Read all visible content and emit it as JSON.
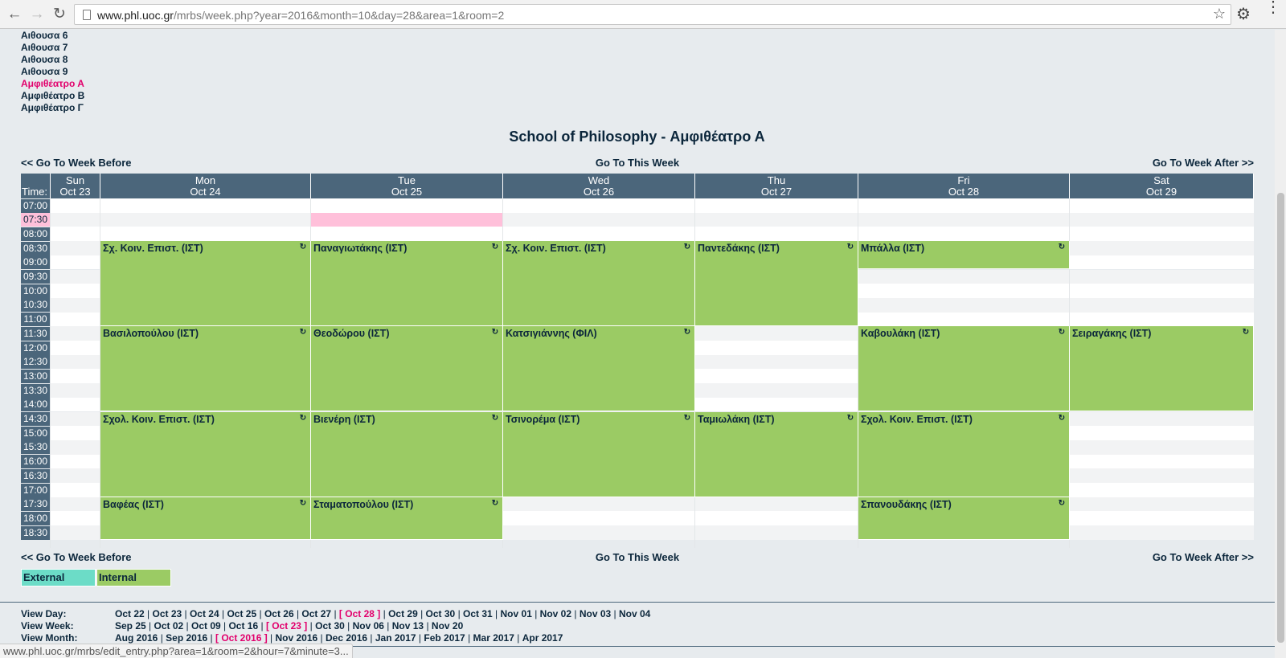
{
  "browser": {
    "url_host": "www.phl.uoc.gr",
    "url_path": "/mrbs/week.php?year=2016&month=10&day=28&area=1&room=2",
    "status_url": "www.phl.uoc.gr/mrbs/edit_entry.php?area=1&room=2&hour=7&minute=3..."
  },
  "rooms": [
    {
      "label": "Αιθουσα 6",
      "current": false
    },
    {
      "label": "Αιθουσα 7",
      "current": false
    },
    {
      "label": "Αιθουσα 8",
      "current": false
    },
    {
      "label": "Αιθουσα 9",
      "current": false
    },
    {
      "label": "Αμφιθέατρο Α",
      "current": true
    },
    {
      "label": "Αμφιθέατρο Β",
      "current": false
    },
    {
      "label": "Αμφιθέατρο Γ",
      "current": false
    }
  ],
  "page_title": "School of Philosophy - Αμφιθέατρο Α",
  "week_nav": {
    "prev": "<< Go To Week Before",
    "this": "Go To This Week",
    "next": "Go To Week After >>"
  },
  "time_label": "Time:",
  "days": [
    {
      "name": "Sun",
      "date": "Oct 23"
    },
    {
      "name": "Mon",
      "date": "Oct 24"
    },
    {
      "name": "Tue",
      "date": "Oct 25"
    },
    {
      "name": "Wed",
      "date": "Oct 26"
    },
    {
      "name": "Thu",
      "date": "Oct 27"
    },
    {
      "name": "Fri",
      "date": "Oct 28"
    },
    {
      "name": "Sat",
      "date": "Oct 29"
    }
  ],
  "times": [
    "07:00",
    "07:30",
    "08:00",
    "08:30",
    "09:00",
    "09:30",
    "10:00",
    "10:30",
    "11:00",
    "11:30",
    "12:00",
    "12:30",
    "13:00",
    "13:30",
    "14:00",
    "14:30",
    "15:00",
    "15:30",
    "16:00",
    "16:30",
    "17:00",
    "17:30",
    "18:00",
    "18:30"
  ],
  "highlight": {
    "day": 2,
    "slot": 1
  },
  "bookings": [
    {
      "day": 1,
      "start": 3,
      "slots": 6,
      "label": "Σχ. Κοιν. Επιστ. (ΙΣΤ)",
      "type": "internal"
    },
    {
      "day": 1,
      "start": 9,
      "slots": 6,
      "label": "Βασιλοπούλου (ΙΣΤ)",
      "type": "internal"
    },
    {
      "day": 1,
      "start": 15,
      "slots": 6,
      "label": "Σχολ. Κοιν. Επιστ. (ΙΣΤ)",
      "type": "internal"
    },
    {
      "day": 1,
      "start": 21,
      "slots": 3,
      "label": "Βαφέας (ΙΣΤ)",
      "type": "internal"
    },
    {
      "day": 2,
      "start": 3,
      "slots": 6,
      "label": "Παναγιωτάκης (ΙΣΤ)",
      "type": "internal"
    },
    {
      "day": 2,
      "start": 9,
      "slots": 6,
      "label": "Θεοδώρου (ΙΣΤ)",
      "type": "internal"
    },
    {
      "day": 2,
      "start": 15,
      "slots": 6,
      "label": "Βιενέρη (ΙΣΤ)",
      "type": "internal"
    },
    {
      "day": 2,
      "start": 21,
      "slots": 3,
      "label": "Σταματοπούλου (ΙΣΤ)",
      "type": "internal"
    },
    {
      "day": 3,
      "start": 3,
      "slots": 6,
      "label": "Σχ. Κοιν. Επιστ. (ΙΣΤ)",
      "type": "internal"
    },
    {
      "day": 3,
      "start": 9,
      "slots": 6,
      "label": "Κατσιγιάννης (ΦΙΛ)",
      "type": "internal"
    },
    {
      "day": 3,
      "start": 15,
      "slots": 6,
      "label": "Τσινορέμα (ΙΣΤ)",
      "type": "internal"
    },
    {
      "day": 4,
      "start": 3,
      "slots": 6,
      "label": "Παντεδάκης (ΙΣΤ)",
      "type": "internal"
    },
    {
      "day": 4,
      "start": 15,
      "slots": 6,
      "label": "Ταμιωλάκη (ΙΣΤ)",
      "type": "internal"
    },
    {
      "day": 5,
      "start": 3,
      "slots": 2,
      "label": "Μπάλλα (ΙΣΤ)",
      "type": "internal"
    },
    {
      "day": 5,
      "start": 9,
      "slots": 6,
      "label": "Καβουλάκη (ΙΣΤ)",
      "type": "internal"
    },
    {
      "day": 5,
      "start": 15,
      "slots": 6,
      "label": "Σχολ. Κοιν. Επιστ. (ΙΣΤ)",
      "type": "internal"
    },
    {
      "day": 5,
      "start": 21,
      "slots": 3,
      "label": "Σπανουδάκης (ΙΣΤ)",
      "type": "internal"
    },
    {
      "day": 6,
      "start": 9,
      "slots": 6,
      "label": "Σειραγάκης (ΙΣΤ)",
      "type": "internal"
    }
  ],
  "legend": [
    {
      "label": "External",
      "color": "#6cdcc7"
    },
    {
      "label": "Internal",
      "color": "#9bcb64"
    }
  ],
  "view_nav": [
    {
      "label": "View Day:",
      "items": [
        "Oct 22",
        "Oct 23",
        "Oct 24",
        "Oct 25",
        "Oct 26",
        "Oct 27",
        "Oct 28",
        "Oct 29",
        "Oct 30",
        "Oct 31",
        "Nov 01",
        "Nov 02",
        "Nov 03",
        "Nov 04"
      ],
      "current": "Oct 28"
    },
    {
      "label": "View Week:",
      "items": [
        "Sep 25",
        "Oct 02",
        "Oct 09",
        "Oct 16",
        "Oct 23",
        "Oct 30",
        "Nov 06",
        "Nov 13",
        "Nov 20"
      ],
      "current": "Oct 23"
    },
    {
      "label": "View Month:",
      "items": [
        "Aug 2016",
        "Sep 2016",
        "Oct 2016",
        "Nov 2016",
        "Dec 2016",
        "Jan 2017",
        "Feb 2017",
        "Mar 2017",
        "Apr 2017"
      ],
      "current": "Oct 2016"
    }
  ],
  "colors": {
    "header_bg": "#4b667b",
    "booking_internal": "#9bcb64",
    "booking_external": "#6cdcc7",
    "highlight": "#ffc0da",
    "accent": "#e2006c"
  }
}
